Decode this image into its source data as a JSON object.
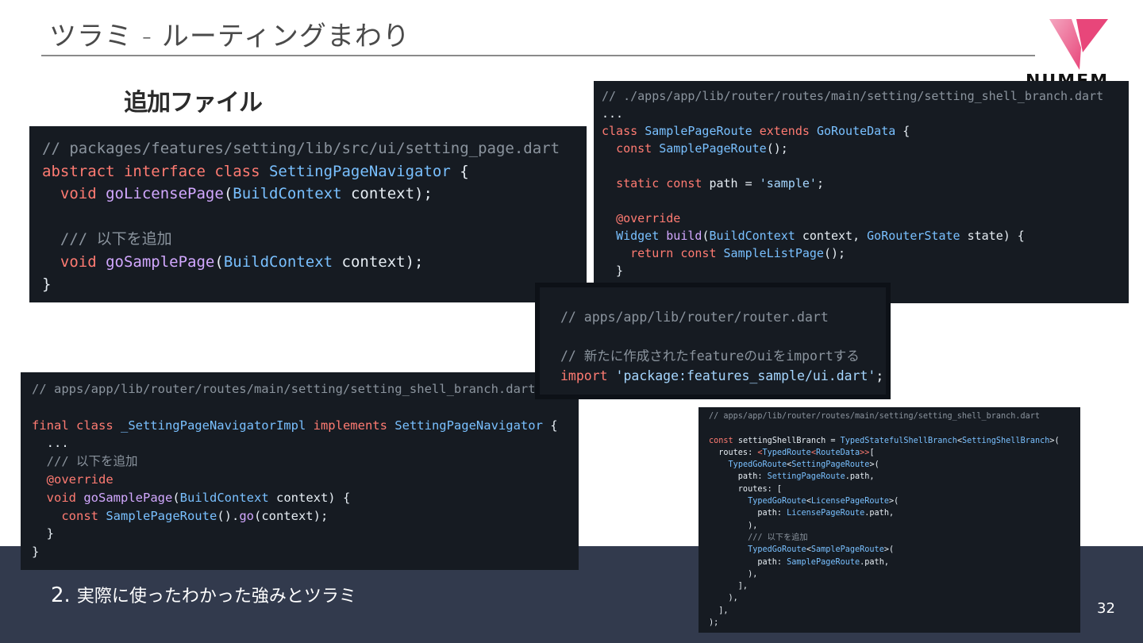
{
  "slide": {
    "title": "ツラミ - ルーティングまわり",
    "subheading": "追加ファイル",
    "logo_text": "NUMEM",
    "footer_number": "2.",
    "footer_text": "実際に使ったわかった強みとツラミ",
    "page_number": "32"
  },
  "colors": {
    "footer_bg": "#323a4d",
    "code_bg": "#161b22",
    "logo_pink": "#e8467a",
    "syntax_keyword": "#ff7b72",
    "syntax_type": "#79c0ff",
    "syntax_function": "#d2a8ff",
    "syntax_comment": "#8b949e",
    "syntax_string": "#a5d6ff"
  },
  "snippet1": [
    [
      [
        "cm",
        "// packages/features/setting/lib/src/ui/setting_page.dart"
      ]
    ],
    [
      [
        "kw",
        "abstract interface class "
      ],
      [
        "ty",
        "SettingPageNavigator"
      ],
      [
        "tx",
        " {"
      ]
    ],
    [
      [
        "tx",
        "  "
      ],
      [
        "kw",
        "void "
      ],
      [
        "fn",
        "goLicensePage"
      ],
      [
        "tx",
        "("
      ],
      [
        "ty",
        "BuildContext"
      ],
      [
        "tx",
        " context);"
      ]
    ],
    [
      [
        "tx",
        ""
      ]
    ],
    [
      [
        "cm",
        "  /// 以下を追加"
      ]
    ],
    [
      [
        "tx",
        "  "
      ],
      [
        "kw",
        "void "
      ],
      [
        "fn",
        "goSamplePage"
      ],
      [
        "tx",
        "("
      ],
      [
        "ty",
        "BuildContext"
      ],
      [
        "tx",
        " context);"
      ]
    ],
    [
      [
        "tx",
        "}"
      ]
    ]
  ],
  "snippet2": [
    [
      [
        "cm",
        "// ./apps/app/lib/router/routes/main/setting/setting_shell_branch.dart"
      ]
    ],
    [
      [
        "tx",
        "..."
      ]
    ],
    [
      [
        "kw",
        "class "
      ],
      [
        "ty",
        "SamplePageRoute "
      ],
      [
        "kw",
        "extends "
      ],
      [
        "ty",
        "GoRouteData"
      ],
      [
        "tx",
        " {"
      ]
    ],
    [
      [
        "tx",
        "  "
      ],
      [
        "kw",
        "const "
      ],
      [
        "ty",
        "SamplePageRoute"
      ],
      [
        "tx",
        "();"
      ]
    ],
    [
      [
        "tx",
        ""
      ]
    ],
    [
      [
        "tx",
        "  "
      ],
      [
        "kw",
        "static const "
      ],
      [
        "tx",
        "path = "
      ],
      [
        "st",
        "'sample'"
      ],
      [
        "tx",
        ";"
      ]
    ],
    [
      [
        "tx",
        ""
      ]
    ],
    [
      [
        "tx",
        "  "
      ],
      [
        "kw",
        "@override"
      ]
    ],
    [
      [
        "tx",
        "  "
      ],
      [
        "ty",
        "Widget "
      ],
      [
        "fn",
        "build"
      ],
      [
        "tx",
        "("
      ],
      [
        "ty",
        "BuildContext"
      ],
      [
        "tx",
        " context, "
      ],
      [
        "ty",
        "GoRouterState"
      ],
      [
        "tx",
        " state) {"
      ]
    ],
    [
      [
        "tx",
        "    "
      ],
      [
        "kw",
        "return const "
      ],
      [
        "ty",
        "SampleListPage"
      ],
      [
        "tx",
        "();"
      ]
    ],
    [
      [
        "tx",
        "  }"
      ]
    ]
  ],
  "snippet3": [
    [
      [
        "cm",
        "// apps/app/lib/router/router.dart"
      ]
    ],
    [
      [
        "tx",
        ""
      ]
    ],
    [
      [
        "cm",
        "// 新たに作成されたfeatureのuiをimportする"
      ]
    ],
    [
      [
        "kw",
        "import "
      ],
      [
        "st",
        "'package:features_sample/ui.dart'"
      ],
      [
        "tx",
        ";"
      ]
    ]
  ],
  "snippet4": [
    [
      [
        "cm",
        "// apps/app/lib/router/routes/main/setting/setting_shell_branch.dart"
      ]
    ],
    [
      [
        "tx",
        ""
      ]
    ],
    [
      [
        "kw",
        "final class "
      ],
      [
        "ty",
        "_SettingPageNavigatorImpl "
      ],
      [
        "kw",
        "implements "
      ],
      [
        "ty",
        "SettingPageNavigator"
      ],
      [
        "tx",
        " {"
      ]
    ],
    [
      [
        "tx",
        "  ..."
      ]
    ],
    [
      [
        "cm",
        "  /// 以下を追加"
      ]
    ],
    [
      [
        "tx",
        "  "
      ],
      [
        "kw",
        "@override"
      ]
    ],
    [
      [
        "tx",
        "  "
      ],
      [
        "kw",
        "void "
      ],
      [
        "fn",
        "goSamplePage"
      ],
      [
        "tx",
        "("
      ],
      [
        "ty",
        "BuildContext"
      ],
      [
        "tx",
        " context) {"
      ]
    ],
    [
      [
        "tx",
        "    "
      ],
      [
        "kw",
        "const "
      ],
      [
        "ty",
        "SamplePageRoute"
      ],
      [
        "tx",
        "()."
      ],
      [
        "fn",
        "go"
      ],
      [
        "tx",
        "(context);"
      ]
    ],
    [
      [
        "tx",
        "  }"
      ]
    ],
    [
      [
        "tx",
        "}"
      ]
    ]
  ],
  "snippet5": [
    [
      [
        "cm",
        "// apps/app/lib/router/routes/main/setting/setting_shell_branch.dart"
      ]
    ],
    [
      [
        "tx",
        ""
      ]
    ],
    [
      [
        "kw",
        "const "
      ],
      [
        "tx",
        "settingShellBranch = "
      ],
      [
        "ty",
        "TypedStatefulShellBranch"
      ],
      [
        "tx",
        "<"
      ],
      [
        "ty",
        "SettingShellBranch"
      ],
      [
        "tx",
        ">("
      ]
    ],
    [
      [
        "tx",
        "  routes: "
      ],
      [
        "kw",
        "<"
      ],
      [
        "ty",
        "TypedRoute"
      ],
      [
        "kw",
        "<"
      ],
      [
        "ty",
        "RouteData"
      ],
      [
        "kw",
        ">>"
      ],
      [
        "tx",
        "["
      ]
    ],
    [
      [
        "tx",
        "    "
      ],
      [
        "ty",
        "TypedGoRoute"
      ],
      [
        "tx",
        "<"
      ],
      [
        "ty",
        "SettingPageRoute"
      ],
      [
        "tx",
        ">("
      ]
    ],
    [
      [
        "tx",
        "      path: "
      ],
      [
        "ty",
        "SettingPageRoute"
      ],
      [
        "tx",
        ".path,"
      ]
    ],
    [
      [
        "tx",
        "      routes: ["
      ]
    ],
    [
      [
        "tx",
        "        "
      ],
      [
        "ty",
        "TypedGoRoute"
      ],
      [
        "tx",
        "<"
      ],
      [
        "ty",
        "LicensePageRoute"
      ],
      [
        "tx",
        ">("
      ]
    ],
    [
      [
        "tx",
        "          path: "
      ],
      [
        "ty",
        "LicensePageRoute"
      ],
      [
        "tx",
        ".path,"
      ]
    ],
    [
      [
        "tx",
        "        ),"
      ]
    ],
    [
      [
        "cm",
        "        /// 以下を追加"
      ]
    ],
    [
      [
        "tx",
        "        "
      ],
      [
        "ty",
        "TypedGoRoute"
      ],
      [
        "tx",
        "<"
      ],
      [
        "ty",
        "SamplePageRoute"
      ],
      [
        "tx",
        ">("
      ]
    ],
    [
      [
        "tx",
        "          path: "
      ],
      [
        "ty",
        "SamplePageRoute"
      ],
      [
        "tx",
        ".path,"
      ]
    ],
    [
      [
        "tx",
        "        ),"
      ]
    ],
    [
      [
        "tx",
        "      ],"
      ]
    ],
    [
      [
        "tx",
        "    ),"
      ]
    ],
    [
      [
        "tx",
        "  ],"
      ]
    ],
    [
      [
        "tx",
        ");"
      ]
    ]
  ]
}
